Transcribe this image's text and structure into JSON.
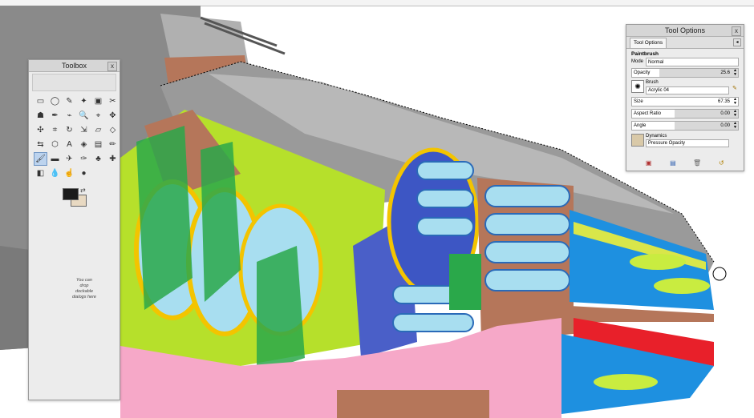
{
  "toolbox": {
    "title": "Toolbox",
    "close": "x",
    "tools": [
      {
        "name": "rect-select-icon",
        "glyph": "▭"
      },
      {
        "name": "ellipse-select-icon",
        "glyph": "◯"
      },
      {
        "name": "free-select-icon",
        "glyph": "✎"
      },
      {
        "name": "fuzzy-select-icon",
        "glyph": "✦"
      },
      {
        "name": "color-select-icon",
        "glyph": "▣"
      },
      {
        "name": "scissors-select-icon",
        "glyph": "✂"
      },
      {
        "name": "foreground-select-icon",
        "glyph": "☗"
      },
      {
        "name": "paths-icon",
        "glyph": "✒"
      },
      {
        "name": "color-picker-icon",
        "glyph": "⌁"
      },
      {
        "name": "zoom-icon",
        "glyph": "🔍"
      },
      {
        "name": "measure-icon",
        "glyph": "⌖"
      },
      {
        "name": "move-icon",
        "glyph": "✥"
      },
      {
        "name": "align-icon",
        "glyph": "✣"
      },
      {
        "name": "crop-icon",
        "glyph": "⌗"
      },
      {
        "name": "rotate-icon",
        "glyph": "↻"
      },
      {
        "name": "scale-icon",
        "glyph": "⇲"
      },
      {
        "name": "shear-icon",
        "glyph": "▱"
      },
      {
        "name": "perspective-icon",
        "glyph": "◇"
      },
      {
        "name": "flip-icon",
        "glyph": "⇆"
      },
      {
        "name": "cage-icon",
        "glyph": "⬡"
      },
      {
        "name": "text-icon",
        "glyph": "A"
      },
      {
        "name": "bucket-fill-icon",
        "glyph": "◈"
      },
      {
        "name": "blend-icon",
        "glyph": "▤"
      },
      {
        "name": "pencil-icon",
        "glyph": "✏"
      },
      {
        "name": "paintbrush-icon",
        "glyph": "🖌"
      },
      {
        "name": "eraser-icon",
        "glyph": "▬"
      },
      {
        "name": "airbrush-icon",
        "glyph": "✈"
      },
      {
        "name": "ink-icon",
        "glyph": "✑"
      },
      {
        "name": "clone-icon",
        "glyph": "♣"
      },
      {
        "name": "heal-icon",
        "glyph": "✚"
      },
      {
        "name": "perspective-clone-icon",
        "glyph": "◧"
      },
      {
        "name": "blur-icon",
        "glyph": "💧"
      },
      {
        "name": "smudge-icon",
        "glyph": "☝"
      },
      {
        "name": "dodge-burn-icon",
        "glyph": "●"
      }
    ],
    "drop_note": "You can drop dockable dialogs here"
  },
  "tool_options": {
    "title": "Tool Options",
    "close": "x",
    "tab_label": "Tool Options",
    "tool_name": "Paintbrush",
    "mode_label": "Mode",
    "mode_value": "Normal",
    "opacity_label": "Opacity",
    "opacity_value": "25.6",
    "opacity_fraction": 0.256,
    "brush_label": "Brush",
    "brush_value": "Acrylic 04",
    "size_label": "Size",
    "size_value": "67.35",
    "aspect_label": "Aspect Ratio",
    "aspect_value": "0.00",
    "angle_label": "Angle",
    "angle_value": "0.00",
    "dynamics_label": "Dynamics",
    "dynamics_value": "Pressure Opacity"
  },
  "colors": {
    "foreground": "#1a1a1a",
    "background": "#e8d9c2",
    "canvas_bg": "#ffffff"
  }
}
